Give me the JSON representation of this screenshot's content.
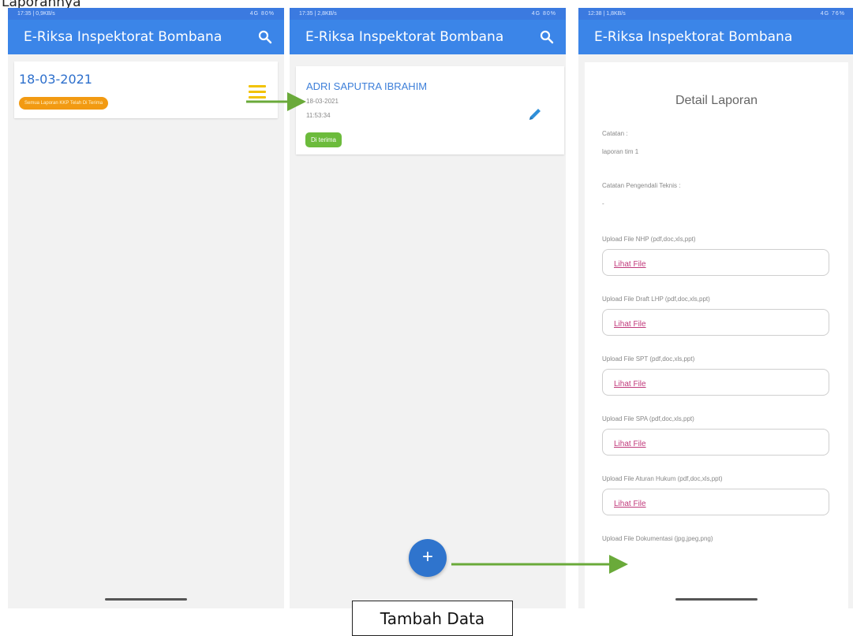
{
  "caption_top": "Laporannya",
  "caption_bottom": "Tambah Data",
  "colors": {
    "appbar": "#3b85e8",
    "badge_orange": "#f29a12",
    "badge_green": "#6cbb3c",
    "fab": "#2f74cd",
    "arrow": "#6aaa3a",
    "link": "#c0387a"
  },
  "screens": [
    {
      "status_left": "17:35 | 0,9KB/s",
      "status_right": "4G 80%",
      "app_title": "E-Riksa Inspektorat Bombana",
      "card": {
        "date": "18-03-2021",
        "badge": "Semua Laporan KKP Telah Di Terima"
      }
    },
    {
      "status_left": "17:35 | 2,8KB/s",
      "status_right": "4G 80%",
      "app_title": "E-Riksa Inspektorat Bombana",
      "card": {
        "name": "ADRI SAPUTRA IBRAHIM",
        "date": "18-03-2021",
        "time": "11:53:34",
        "status": "Di terima"
      },
      "fab_label": "+"
    },
    {
      "status_left": "12:38 | 1,8KB/s",
      "status_right": "4G 76%",
      "app_title": "E-Riksa Inspektorat Bombana",
      "heading": "Detail Laporan",
      "catatan_label": "Catatan :",
      "catatan_value": "laporan tim 1",
      "catatan_teknis_label": "Catatan Pengendali Teknis :",
      "catatan_teknis_value": "-",
      "link_label": "Lihat File",
      "uploads": [
        "Upload File NHP (pdf,doc,xls,ppt)",
        "Upload File Draft LHP (pdf,doc,xls,ppt)",
        "Upload File SPT (pdf,doc,xls,ppt)",
        "Upload File SPA (pdf,doc,xls,ppt)",
        "Upload File Aturan Hukum (pdf,doc,xls,ppt)",
        "Upload File Dokumentasi (jpg,jpeg,png)"
      ]
    }
  ]
}
